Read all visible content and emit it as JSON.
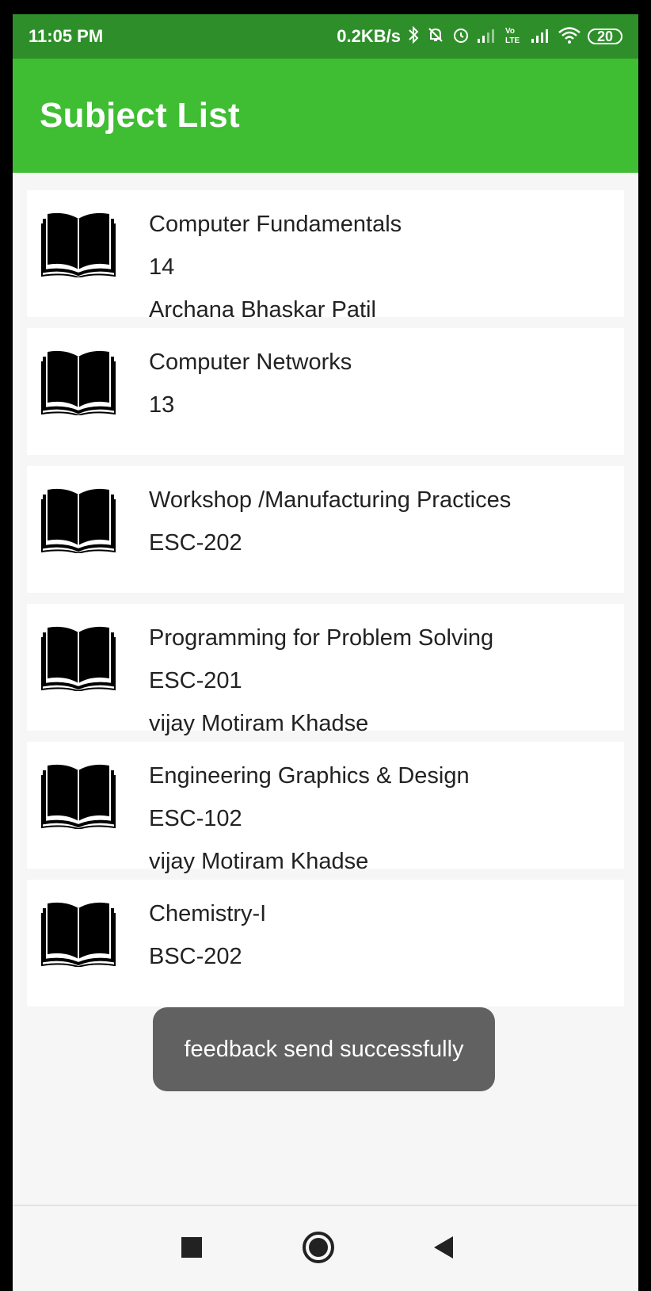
{
  "status_bar": {
    "time": "11:05 PM",
    "speed": "0.2KB/s",
    "battery": "20",
    "icons": [
      "bluetooth-icon",
      "mute-icon",
      "alarm-icon",
      "signal-icon",
      "volte-lte-icon",
      "signal-icon",
      "wifi-icon",
      "battery-icon"
    ]
  },
  "app_bar": {
    "title": "Subject List"
  },
  "subjects": [
    {
      "name": "Computer Fundamentals",
      "code": "14",
      "teacher": "Archana Bhaskar Patil"
    },
    {
      "name": "Computer Networks",
      "code": "13",
      "teacher": ""
    },
    {
      "name": "Workshop /Manufacturing Practices",
      "code": "ESC-202",
      "teacher": ""
    },
    {
      "name": "Programming for Problem Solving",
      "code": "ESC-201",
      "teacher": "vijay Motiram Khadse"
    },
    {
      "name": "Engineering Graphics & Design",
      "code": "ESC-102",
      "teacher": "vijay Motiram Khadse"
    },
    {
      "name": "Chemistry-I",
      "code": "BSC-202",
      "teacher": ""
    }
  ],
  "toast": {
    "message": "feedback send successfully"
  },
  "nav_bar": {
    "icons": [
      "recents-icon",
      "home-icon",
      "back-icon"
    ]
  },
  "colors": {
    "status_bar": "#2e8f2a",
    "app_bar": "#3fbd33",
    "background": "#f6f6f6",
    "toast": "#616161"
  }
}
